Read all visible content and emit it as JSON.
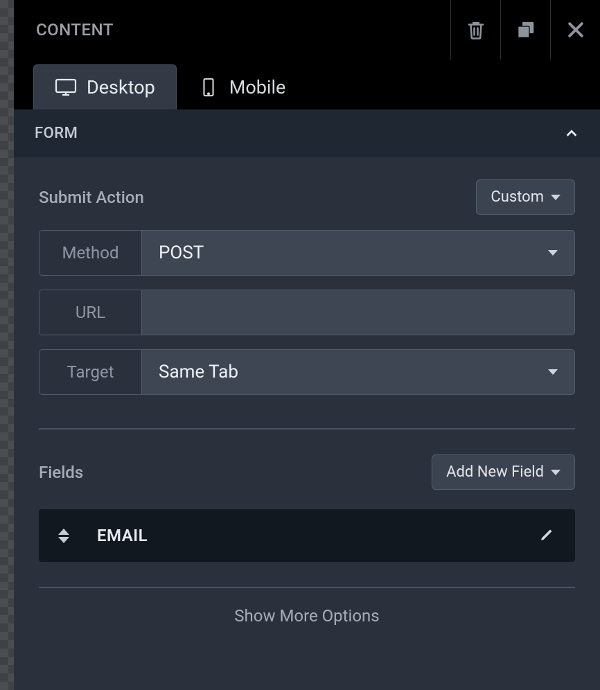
{
  "header": {
    "title": "CONTENT"
  },
  "tabs": {
    "desktop": "Desktop",
    "mobile": "Mobile"
  },
  "section": {
    "title": "FORM"
  },
  "form": {
    "submit_action_label": "Submit Action",
    "submit_action_value": "Custom",
    "method_label": "Method",
    "method_value": "POST",
    "url_label": "URL",
    "url_value": "",
    "target_label": "Target",
    "target_value": "Same Tab"
  },
  "fields": {
    "label": "Fields",
    "add_button": "Add New Field",
    "items": [
      {
        "name": "EMAIL"
      }
    ]
  },
  "footer": {
    "show_more": "Show More Options"
  }
}
